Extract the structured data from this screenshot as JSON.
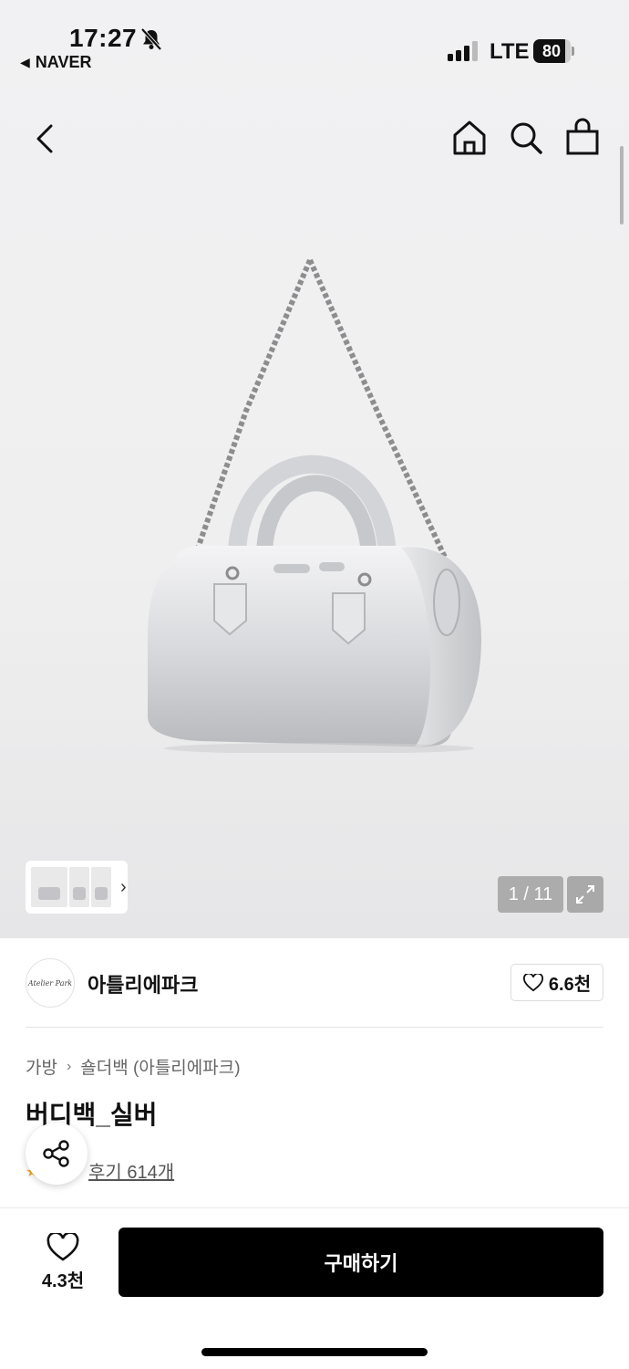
{
  "status_bar": {
    "time": "17:27",
    "back_app": "NAVER",
    "network": "LTE",
    "battery": "80"
  },
  "nav": {
    "icons": [
      "back-icon",
      "home-icon",
      "search-icon",
      "shopping-bag-icon"
    ]
  },
  "gallery": {
    "counter": "1 / 11",
    "thumbnail_more": "›"
  },
  "seller": {
    "logo_text": "Atelier Park",
    "name": "아틀리에파크",
    "favorite_count": "6.6천"
  },
  "product": {
    "breadcrumb": [
      "가방",
      "숄더백 (아틀리에파크)"
    ],
    "breadcrumb_sep": "›",
    "title": "버디백_실버",
    "review_link": "후기 614개"
  },
  "bottom_bar": {
    "wish_count": "4.3천",
    "buy_label": "구매하기"
  },
  "colors": {
    "accent": "#000000",
    "star": "#f5a623"
  }
}
